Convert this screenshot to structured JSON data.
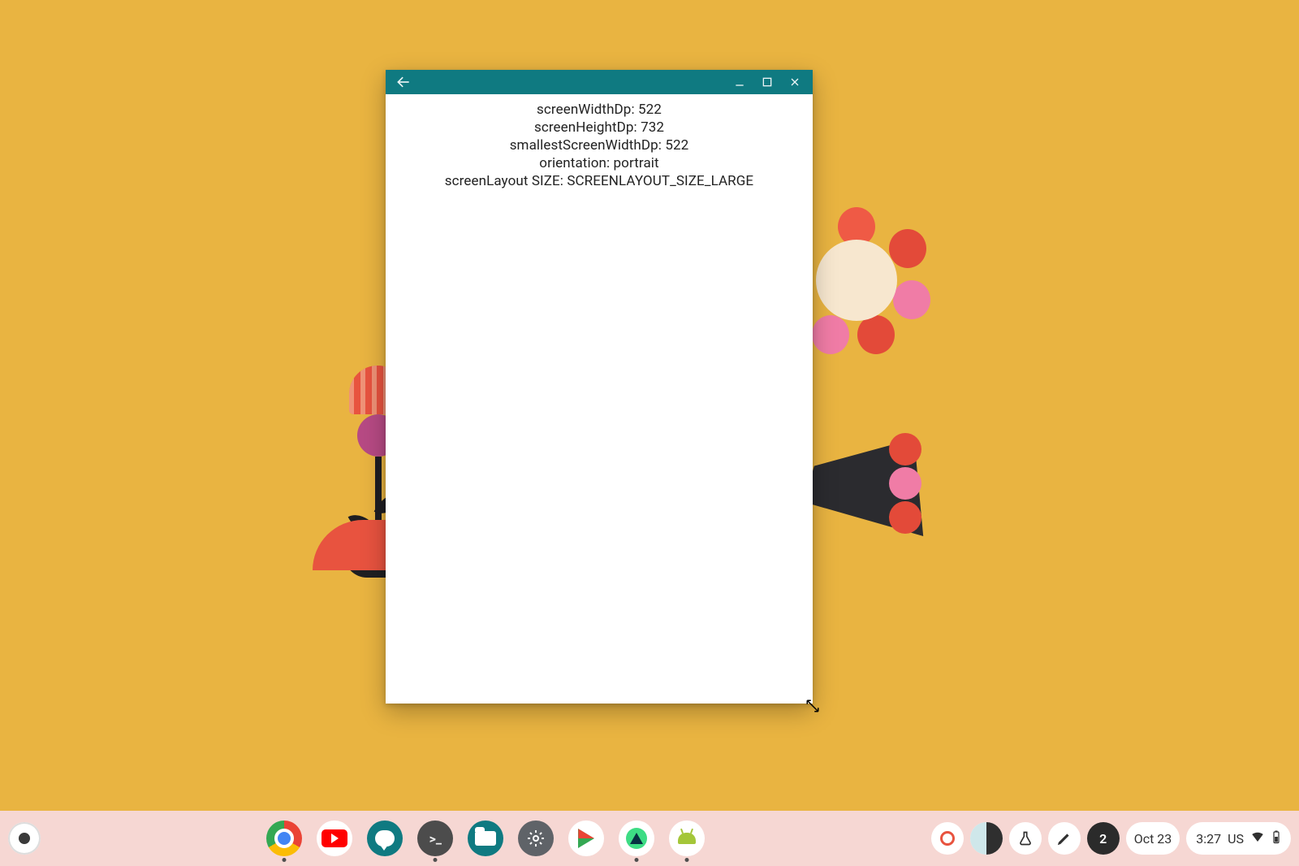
{
  "window": {
    "titlebar_color": "#0f7a81",
    "controls": {
      "back": "Back",
      "minimize": "Minimize",
      "maximize": "Maximize",
      "close": "Close"
    },
    "content": {
      "rows": [
        {
          "label": "screenWidthDp",
          "value": "522"
        },
        {
          "label": "screenHeightDp",
          "value": "732"
        },
        {
          "label": "smallestScreenWidthDp",
          "value": "522"
        },
        {
          "label": "orientation",
          "value": "portrait"
        },
        {
          "label": "screenLayout SIZE",
          "value": "SCREENLAYOUT_SIZE_LARGE"
        }
      ]
    }
  },
  "shelf": {
    "apps": [
      {
        "id": "chrome",
        "label": "Google Chrome",
        "running": true
      },
      {
        "id": "youtube",
        "label": "YouTube",
        "running": false
      },
      {
        "id": "chat",
        "label": "Messages",
        "running": false
      },
      {
        "id": "terminal",
        "label": "Terminal",
        "running": true
      },
      {
        "id": "files",
        "label": "Files",
        "running": false
      },
      {
        "id": "settings",
        "label": "Settings",
        "running": false
      },
      {
        "id": "play",
        "label": "Play Store",
        "running": false
      },
      {
        "id": "studio",
        "label": "Android Studio",
        "running": true
      },
      {
        "id": "android",
        "label": "Android Emulator",
        "running": true
      }
    ]
  },
  "status": {
    "notification_count": "2",
    "date": "Oct 23",
    "time": "3:27",
    "ime": "US"
  }
}
